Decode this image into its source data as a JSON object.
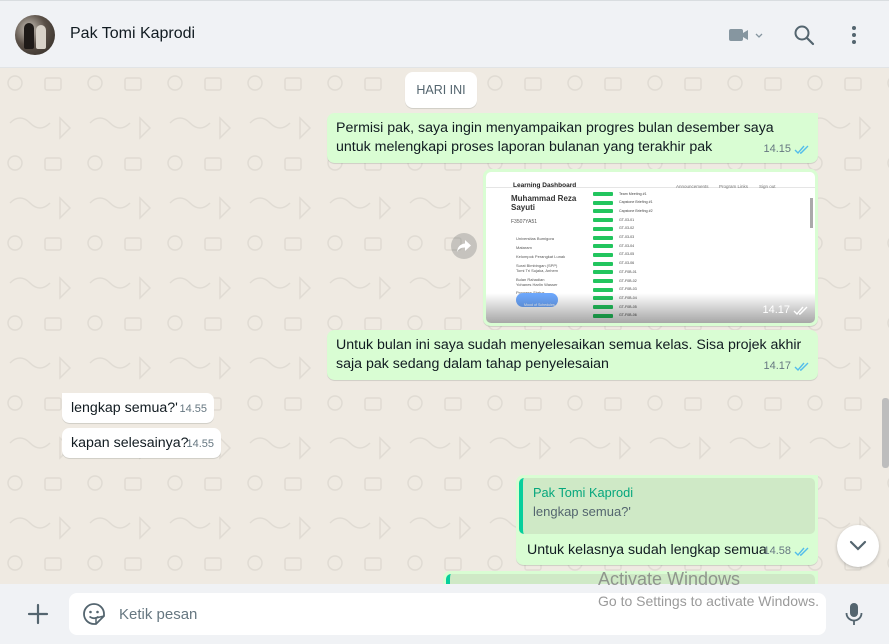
{
  "header": {
    "contact_name": "Pak Tomi Kaprodi"
  },
  "chat": {
    "date_label": "HARI INI",
    "messages": [
      {
        "direction": "out",
        "text": "Permisi pak, saya ingin menyampaikan progres bulan desember saya untuk melengkapi proses laporan bulanan yang terakhir pak",
        "time": "14.15",
        "status": "read"
      },
      {
        "direction": "out",
        "type": "image",
        "time": "14.17",
        "status": "read",
        "image": {
          "title": "Learning Dashboard",
          "nav": [
            "Announcements",
            "Program Links",
            "Sign out"
          ],
          "name": "Muhammad Reza Sayuti",
          "id": "F3507YA51",
          "sidebar": [
            "Universitas Bumigora",
            "Mataram",
            "Kelompok Perangkat Lunak",
            "Surat Bimbingan (SPP)",
            "Tomi Tri Sujaka, Anhem",
            "Bulan Rahadian",
            "Yohanes Harlin Wasser",
            "Progress Status"
          ],
          "sidebar_active": "Mood of Schedules",
          "rows": [
            "Team Meeting #1",
            "Capstone Briefing #1",
            "Capstone Briefing #2",
            "GT-03-01",
            "GT-03-02",
            "GT-03-03",
            "GT-03-04",
            "GT-03-05",
            "GT-03-06",
            "GT-F0B-01",
            "GT-F0B-02",
            "GT-F0B-03",
            "GT-F0B-04",
            "GT-F0B-05",
            "GT-F0B-06"
          ],
          "badge": "Attending"
        }
      },
      {
        "direction": "out",
        "text": "Untuk bulan ini saya sudah menyelesaikan semua kelas. Sisa projek akhir saja pak sedang dalam tahap penyelesaian",
        "time": "14.17",
        "status": "read"
      },
      {
        "direction": "in",
        "text": "lengkap semua?'",
        "time": "14.55"
      },
      {
        "direction": "in",
        "text": "kapan selesainya?",
        "time": "14.55"
      },
      {
        "direction": "out",
        "quoted_name": "Pak Tomi Kaprodi",
        "quoted_text": "lengkap semua?'",
        "text": "Untuk kelasnya sudah lengkap semua",
        "time": "14.58",
        "status": "read"
      }
    ]
  },
  "footer": {
    "input_placeholder": "Ketik pesan",
    "input_value": ""
  },
  "watermark": {
    "line1": "Activate Windows",
    "line2": "Go to Settings to activate Windows."
  },
  "colors": {
    "outgoing_bubble": "#d9fdd3",
    "incoming_bubble": "#ffffff",
    "chat_background": "#efeae2",
    "read_tick": "#53bdeb",
    "accent": "#06cf9c"
  }
}
